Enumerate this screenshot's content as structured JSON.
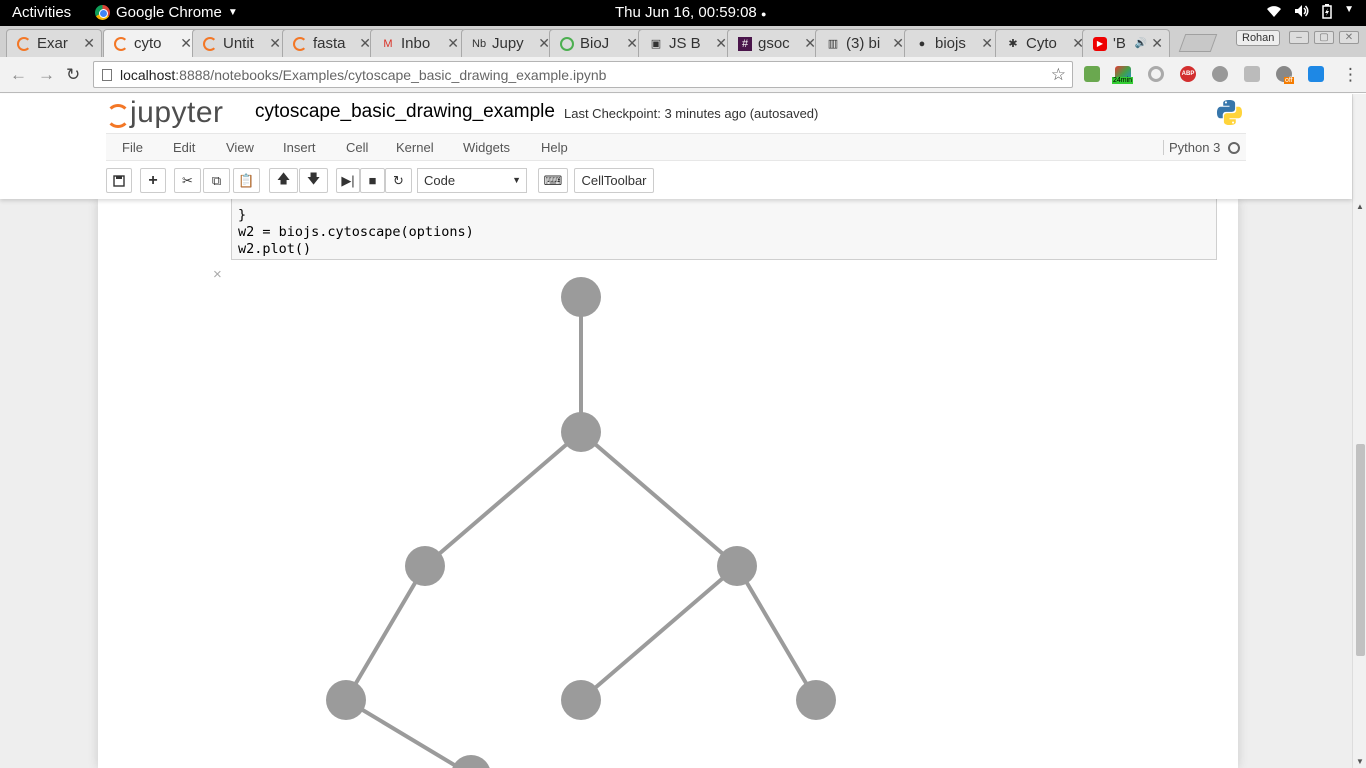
{
  "system_bar": {
    "activities": "Activities",
    "app_name": "Google Chrome",
    "clock": "Thu Jun 16, 00:59:08",
    "tray_icons": [
      "wifi-icon",
      "volume-icon",
      "battery-icon",
      "power-menu-icon"
    ]
  },
  "tabs": [
    {
      "title": "Exar",
      "icon": "jupyter-icon",
      "active": false
    },
    {
      "title": "cyto",
      "icon": "jupyter-icon",
      "active": true
    },
    {
      "title": "Untit",
      "icon": "jupyter-icon",
      "active": false
    },
    {
      "title": "fasta",
      "icon": "jupyter-icon",
      "active": false
    },
    {
      "title": "Inbo",
      "icon": "gmail-icon",
      "active": false
    },
    {
      "title": "Jupy",
      "icon": "jupyter-nb-icon",
      "active": false
    },
    {
      "title": "BioJ",
      "icon": "biojs-icon",
      "active": false
    },
    {
      "title": "JS B",
      "icon": "jsbin-icon",
      "active": false
    },
    {
      "title": "gsoc",
      "icon": "slack-icon",
      "active": false
    },
    {
      "title": "(3) bi",
      "icon": "gitter-icon",
      "active": false
    },
    {
      "title": "biojs",
      "icon": "github-icon",
      "active": false
    },
    {
      "title": "Cyto",
      "icon": "cytoscape-icon",
      "active": false
    },
    {
      "title": "'B",
      "icon": "youtube-icon",
      "active": false
    }
  ],
  "profile_name": "Rohan",
  "address_bar": {
    "host": "localhost",
    "path": ":8888/notebooks/Examples/cytoscape_basic_drawing_example.ipynb"
  },
  "extension_badge": "24min",
  "extension_badge_off": "off",
  "jupyter": {
    "logo_text": "jupyter",
    "notebook_title": "cytoscape_basic_drawing_example",
    "checkpoint": "Last Checkpoint: 3 minutes ago (autosaved)",
    "menu": [
      "File",
      "Edit",
      "View",
      "Insert",
      "Cell",
      "Kernel",
      "Widgets",
      "Help"
    ],
    "kernel": "Python 3",
    "cell_type": "Code",
    "celltoolbar_label": "CellToolbar"
  },
  "code_lines": [
    "}",
    "w2 = biojs.cytoscape(options)",
    "w2.plot()"
  ],
  "close_output": "×",
  "colors": {
    "node": "#9b9b9b",
    "edge": "#9b9b9b",
    "jupyter_orange": "#f37726"
  },
  "graph": {
    "nodes": [
      "n1",
      "n2",
      "n3",
      "n4",
      "n5",
      "n6",
      "n7",
      "n8"
    ],
    "edges": [
      [
        "n1",
        "n2"
      ],
      [
        "n2",
        "n3"
      ],
      [
        "n2",
        "n4"
      ],
      [
        "n3",
        "n5"
      ],
      [
        "n4",
        "n6"
      ],
      [
        "n4",
        "n7"
      ],
      [
        "n5",
        "n8"
      ]
    ]
  }
}
